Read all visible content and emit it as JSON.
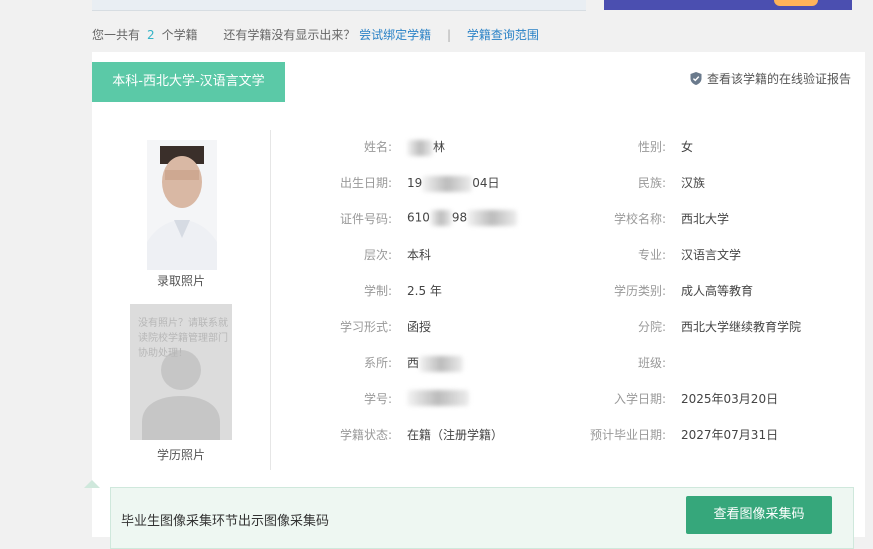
{
  "summary": {
    "prefix": "您一共有",
    "count": "2",
    "suffix": "个学籍",
    "question": "还有学籍没有显示出来？",
    "link_bind": "尝试绑定学籍",
    "separator": "|",
    "link_scope": "学籍查询范围"
  },
  "record": {
    "tab_label": "本科-西北大学-汉语言文学",
    "verify_link": "查看该学籍的在线验证报告",
    "admission_photo_label": "录取照片",
    "degree_photo_hint": "没有照片？请联系就读院校学籍管理部门协助处理！",
    "degree_photo_label": "学历照片"
  },
  "fields_left": [
    {
      "label": "姓名:",
      "value": "林"
    },
    {
      "label": "出生日期:",
      "value_pre": "19",
      "value_post": "04日"
    },
    {
      "label": "证件号码:",
      "value_pre": "610",
      "value_post": "98"
    },
    {
      "label": "层次:",
      "value": "本科"
    },
    {
      "label": "学制:",
      "value": "2.5 年"
    },
    {
      "label": "学习形式:",
      "value": "函授"
    },
    {
      "label": "系所:",
      "value": "西"
    },
    {
      "label": "学号:",
      "value": ""
    },
    {
      "label": "学籍状态:",
      "value": "在籍（注册学籍）"
    }
  ],
  "fields_right": [
    {
      "label": "性别:",
      "value": "女"
    },
    {
      "label": "民族:",
      "value": "汉族"
    },
    {
      "label": "学校名称:",
      "value": "西北大学"
    },
    {
      "label": "专业:",
      "value": "汉语言文学"
    },
    {
      "label": "学历类别:",
      "value": "成人高等教育"
    },
    {
      "label": "分院:",
      "value": "西北大学继续教育学院"
    },
    {
      "label": "班级:",
      "value": ""
    },
    {
      "label": "入学日期:",
      "value": "2025年03月20日"
    },
    {
      "label": "预计毕业日期:",
      "value": "2027年07月31日"
    }
  ],
  "bottom": {
    "notice": "毕业生图像采集环节出示图像采集码",
    "button": "查看图像采集码"
  },
  "colors": {
    "tab_green": "#5bc9a7",
    "button_green": "#36a77b",
    "link_blue": "#2a82c6"
  }
}
